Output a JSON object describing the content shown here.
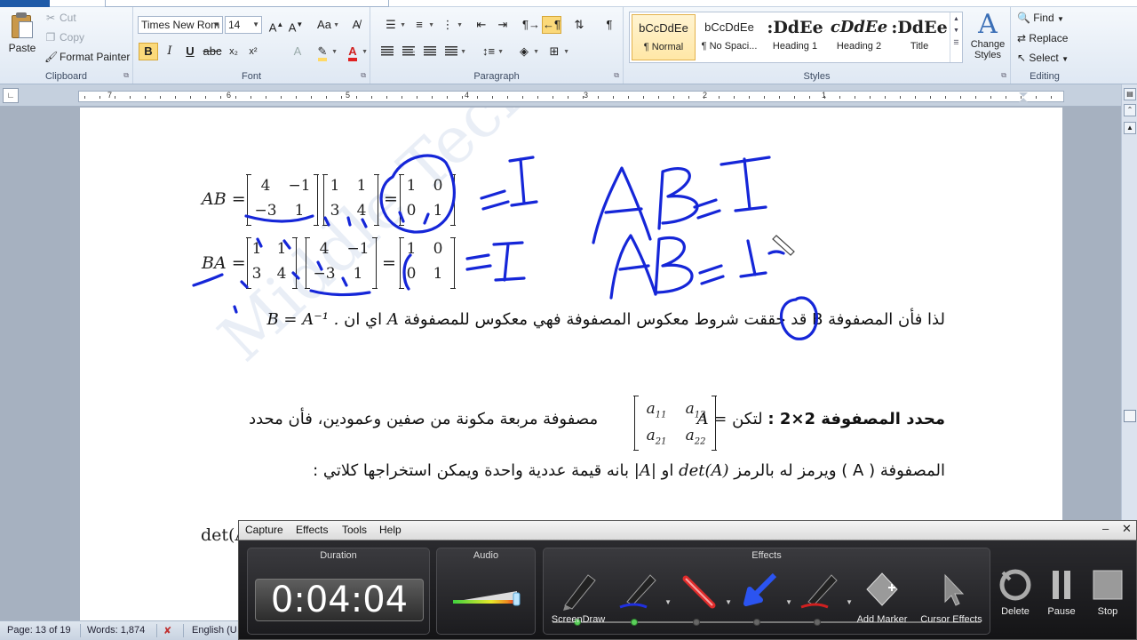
{
  "ribbon": {
    "clipboard": {
      "paste": "Paste",
      "cut": "Cut",
      "copy": "Copy",
      "format_painter": "Format Painter",
      "label": "Clipboard"
    },
    "font": {
      "family": "Times New Rom",
      "size": "14",
      "label": "Font",
      "bold": "B",
      "italic": "I",
      "underline": "U"
    },
    "paragraph": {
      "label": "Paragraph"
    },
    "styles": {
      "label": "Styles",
      "items": [
        {
          "preview": "bCcDdEe",
          "name": "¶ Normal"
        },
        {
          "preview": "bCcDdEe",
          "name": "¶ No Spaci..."
        },
        {
          "preview": ":DdEe",
          "name": "Heading 1"
        },
        {
          "preview": "cDdEe",
          "name": "Heading 2"
        },
        {
          "preview": ":DdEe",
          "name": "Title"
        }
      ],
      "change_styles": "Change Styles"
    },
    "editing": {
      "find": "Find",
      "replace": "Replace",
      "select": "Select",
      "label": "Editing"
    }
  },
  "ruler": {
    "numbers": [
      "7",
      "6",
      "5",
      "4",
      "3",
      "2",
      "1"
    ]
  },
  "document": {
    "ab_label": "AB =",
    "ba_label": "BA =",
    "ab_m1": [
      "4",
      "−1",
      "−3",
      "1"
    ],
    "ab_m2": [
      "1",
      "1",
      "3",
      "4"
    ],
    "ab_m3": [
      "1",
      "0",
      "0",
      "1"
    ],
    "ba_m1": [
      "1",
      "1",
      "3",
      "4"
    ],
    "ba_m2": [
      "4",
      "−1",
      "−3",
      "1"
    ],
    "ba_m3": [
      "1",
      "0",
      "0",
      "1"
    ],
    "eq": "=",
    "para1_text": "لذا فأن المصفوفة B قد حققت شروط معكوس المصفوفة فهي معكوس للمصفوفة",
    "para1_math_a": "A",
    "para1_mid": "اي ان",
    "para1_math_b": "B = A⁻¹ .",
    "det_heading": "محدد المصفوفة 2×2 :",
    "det_text1": "لتكن",
    "det_math_a": "A =",
    "det_cells": [
      "a11",
      "a12",
      "a21",
      "a22"
    ],
    "det_text2": "مصفوفة مربعة مكونة من صفين وعمودين، فأن محدد",
    "para3_text": "المصفوفة ( A ) ويرمز له بالرمز",
    "para3_math": "det(A)",
    "para3_or": "او",
    "para3_abs": "|A|",
    "para3_rest": "بانه قيمة عددية واحدة ويمكن استخراجها كلاتي :",
    "det_line": "det(A",
    "watermark": "Middle Technical Unive"
  },
  "status": {
    "page": "Page: 13 of 19",
    "words": "Words: 1,874",
    "language": "English (U"
  },
  "recorder": {
    "menu": [
      "Capture",
      "Effects",
      "Tools",
      "Help"
    ],
    "duration_title": "Duration",
    "duration": "0:04:04",
    "audio_title": "Audio",
    "effects_title": "Effects",
    "screendraw": "ScreenDraw",
    "add_marker": "Add Marker",
    "cursor_effects": "Cursor Effects",
    "delete": "Delete",
    "pause": "Pause",
    "stop": "Stop"
  },
  "colors": {
    "ink": "#1526d8",
    "highlight": "#ffd966",
    "accent": "#1e5aa8"
  }
}
